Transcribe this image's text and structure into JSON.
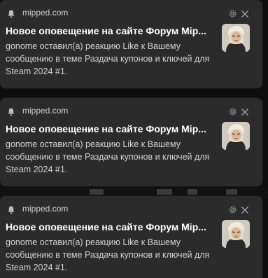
{
  "notifications": [
    {
      "site": "mipped.com",
      "title": "Новое оповещение на сайте Форум Mip...",
      "body": "gonome оставил(а) реакцию Like к Вашему сообщению в теме Раздача купонов и ключей для Steam 2024 #1."
    },
    {
      "site": "mipped.com",
      "title": "Новое оповещение на сайте Форум Mip...",
      "body": "gonome оставил(а) реакцию Like к Вашему сообщению в теме Раздача купонов и ключей для Steam 2024 #1."
    },
    {
      "site": "mipped.com",
      "title": "Новое оповещение на сайте Форум Mip...",
      "body": "gonome оставил(а) реакцию Like к Вашему сообщению в теме Раздача купонов и ключей для Steam 2024 #1."
    }
  ],
  "icons": {
    "app": "bell-icon",
    "settings": "gear-icon",
    "dismiss": "close-icon",
    "sender": "avatar"
  },
  "colors": {
    "card_bg": "#2b2b2b",
    "page_bg": "#0e0e0e",
    "title_text": "#ffffff",
    "body_text": "#d2d2d2"
  }
}
